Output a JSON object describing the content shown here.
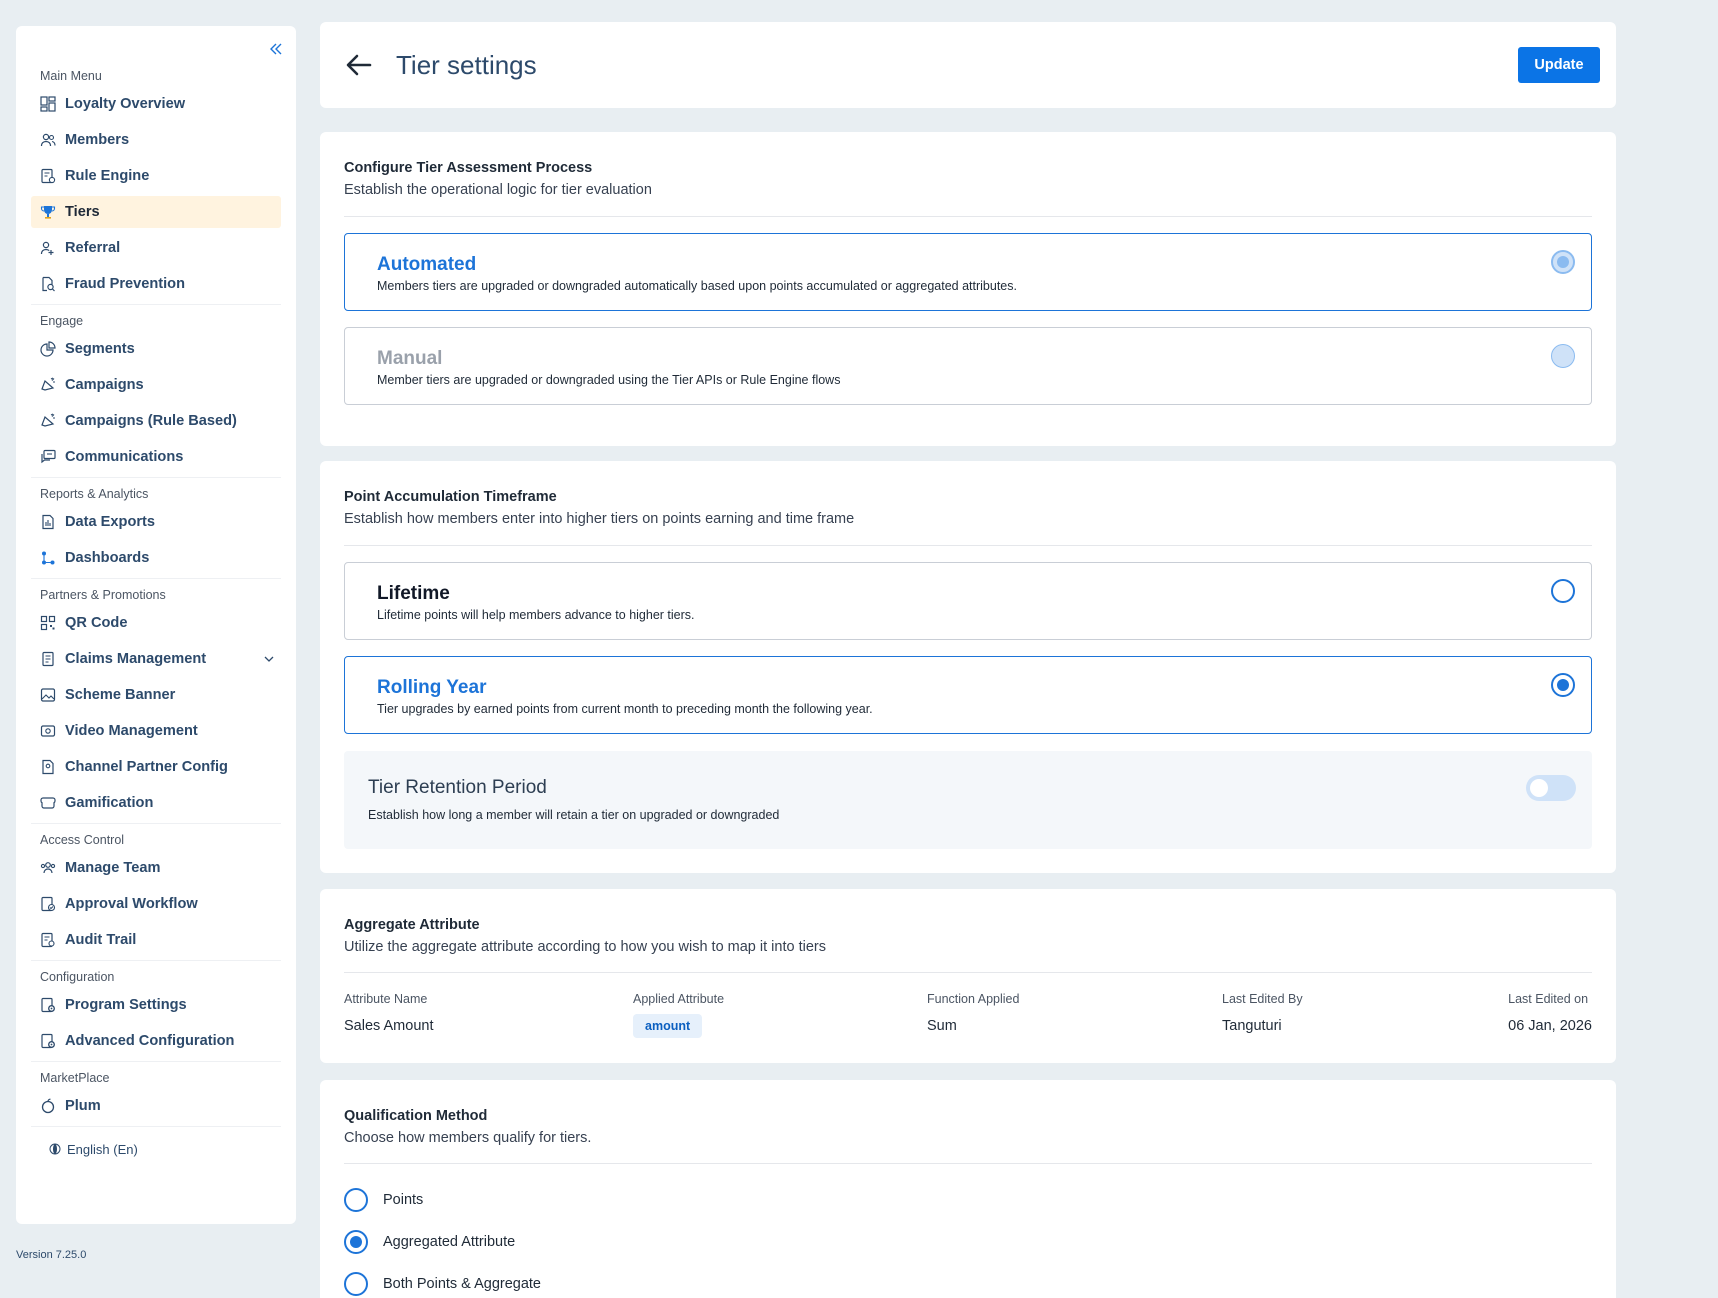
{
  "sidebar": {
    "sections": [
      {
        "label": "Main Menu",
        "items": [
          {
            "label": "Loyalty Overview",
            "icon": "dashboard-grid-icon"
          },
          {
            "label": "Members",
            "icon": "users-icon"
          },
          {
            "label": "Rule Engine",
            "icon": "rule-engine-icon"
          },
          {
            "label": "Tiers",
            "icon": "trophy-icon",
            "active": true
          },
          {
            "label": "Referral",
            "icon": "referral-icon"
          },
          {
            "label": "Fraud Prevention",
            "icon": "fraud-search-icon"
          }
        ]
      },
      {
        "label": "Engage",
        "items": [
          {
            "label": "Segments",
            "icon": "pie-chart-icon"
          },
          {
            "label": "Campaigns",
            "icon": "megaphone-icon"
          },
          {
            "label": "Campaigns (Rule Based)",
            "icon": "megaphone-icon"
          },
          {
            "label": "Communications",
            "icon": "chat-icon"
          }
        ]
      },
      {
        "label": "Reports & Analytics",
        "items": [
          {
            "label": "Data Exports",
            "icon": "file-export-icon"
          },
          {
            "label": "Dashboards",
            "icon": "nodes-icon"
          }
        ]
      },
      {
        "label": "Partners & Promotions",
        "items": [
          {
            "label": "QR Code",
            "icon": "qr-code-icon"
          },
          {
            "label": "Claims Management",
            "icon": "document-icon",
            "expandable": true
          },
          {
            "label": "Scheme Banner",
            "icon": "image-icon"
          },
          {
            "label": "Video Management",
            "icon": "video-icon"
          },
          {
            "label": "Channel Partner Config",
            "icon": "partner-doc-icon"
          },
          {
            "label": "Gamification",
            "icon": "gamepad-icon"
          }
        ]
      },
      {
        "label": "Access Control",
        "items": [
          {
            "label": "Manage Team",
            "icon": "team-icon"
          },
          {
            "label": "Approval Workflow",
            "icon": "approval-icon"
          },
          {
            "label": "Audit Trail",
            "icon": "audit-icon"
          }
        ]
      },
      {
        "label": "Configuration",
        "items": [
          {
            "label": "Program Settings",
            "icon": "settings-doc-icon"
          },
          {
            "label": "Advanced Configuration",
            "icon": "settings-doc-icon"
          }
        ]
      },
      {
        "label": "MarketPlace",
        "items": [
          {
            "label": "Plum",
            "icon": "plum-icon"
          }
        ]
      }
    ],
    "language": "English (En)",
    "version": "Version 7.25.0"
  },
  "header": {
    "title": "Tier settings",
    "update_label": "Update"
  },
  "assessment": {
    "title": "Configure Tier Assessment Process",
    "subtitle": "Establish the operational logic for tier evaluation",
    "options": [
      {
        "title": "Automated",
        "desc": "Members tiers are upgraded or downgraded automatically based upon points accumulated or aggregated attributes.",
        "selected": true
      },
      {
        "title": "Manual",
        "desc": "Member tiers are upgraded or downgraded using the Tier APIs or Rule Engine flows",
        "selected": false
      }
    ]
  },
  "timeframe": {
    "title": "Point Accumulation Timeframe",
    "subtitle": "Establish how members enter into higher tiers on points earning and time frame",
    "options": [
      {
        "title": "Lifetime",
        "desc": "Lifetime points will help members advance to higher tiers.",
        "selected": false
      },
      {
        "title": "Rolling Year",
        "desc": "Tier upgrades by earned points from current month to preceding month the following year.",
        "selected": true
      }
    ],
    "retention": {
      "title": "Tier Retention Period",
      "desc": "Establish how long a member will retain a tier on upgraded or downgraded",
      "enabled": false
    }
  },
  "aggregate": {
    "title": "Aggregate Attribute",
    "subtitle": "Utilize the aggregate attribute according to how you wish to map it into tiers",
    "columns": [
      "Attribute Name",
      "Applied Attribute",
      "Function Applied",
      "Last Edited By",
      "Last Edited on"
    ],
    "row": {
      "attribute_name": "Sales Amount",
      "applied_attribute": "amount",
      "function_applied": "Sum",
      "last_edited_by": "Tanguturi",
      "last_edited_on": "06 Jan, 2026"
    }
  },
  "qualification": {
    "title": "Qualification Method",
    "subtitle": "Choose how members qualify for tiers.",
    "options": [
      {
        "label": "Points",
        "selected": false
      },
      {
        "label": "Aggregated Attribute",
        "selected": true
      },
      {
        "label": "Both Points & Aggregate",
        "selected": false
      }
    ]
  },
  "colors": {
    "accent": "#1d74d8",
    "active_nav_bg": "#fff3df",
    "update_button": "#0b74e6"
  }
}
